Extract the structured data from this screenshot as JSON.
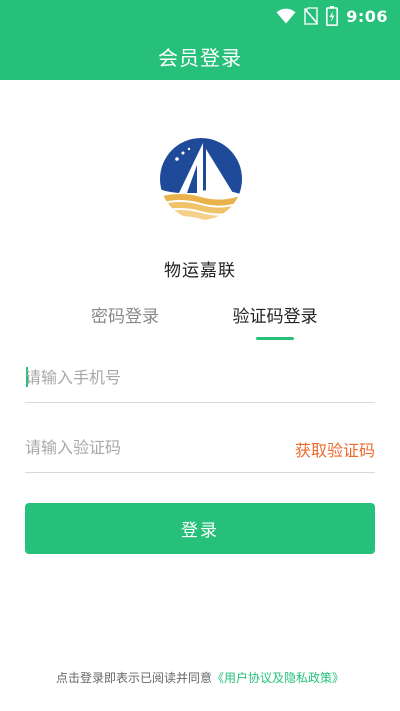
{
  "status_bar": {
    "time": "9:06",
    "icons": [
      "wifi-icon",
      "no-sim-icon",
      "battery-charging-icon"
    ]
  },
  "header": {
    "title": "会员登录"
  },
  "brand": {
    "name": "物运嘉联",
    "logo_icon": "sailboat-logo"
  },
  "tabs": [
    {
      "label": "密码登录",
      "active": false
    },
    {
      "label": "验证码登录",
      "active": true
    }
  ],
  "form": {
    "phone_placeholder": "请输入手机号",
    "code_placeholder": "请输入验证码",
    "get_code_label": "获取验证码",
    "login_label": "登录"
  },
  "agreement": {
    "text": "点击登录即表示已阅读并同意",
    "link_text": "《用户协议及隐私政策》"
  },
  "colors": {
    "primary": "#26c07a",
    "accent_orange": "#ee6a2c",
    "logo_blue": "#1f4a9a",
    "logo_gold": "#e9b24a"
  }
}
